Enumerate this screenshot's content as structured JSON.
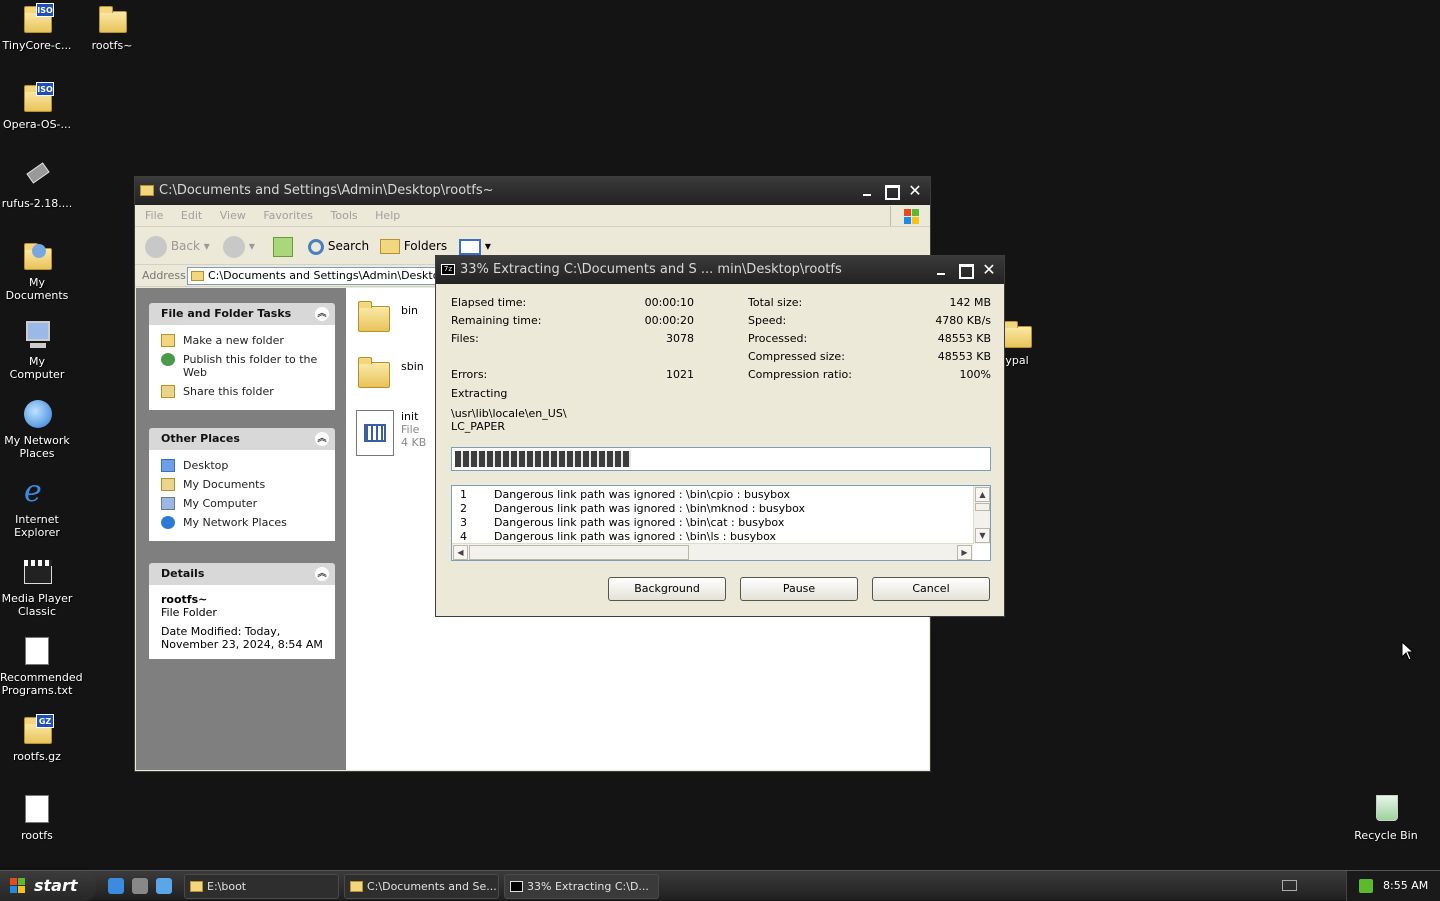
{
  "desktop": {
    "icons": [
      {
        "label": "TinyCore-c...",
        "icon": "iso-file-icon"
      },
      {
        "label": "rootfs~",
        "icon": "folder-icon"
      },
      {
        "label": "Opera-OS-...",
        "icon": "iso-file-icon"
      },
      {
        "label": "rufus-2.18....",
        "icon": "usb-drive-icon"
      },
      {
        "label": "My Documents",
        "icon": "my-documents-icon"
      },
      {
        "label": "My Computer",
        "icon": "my-computer-icon"
      },
      {
        "label": "My Network Places",
        "icon": "network-places-icon"
      },
      {
        "label": "Internet Explorer",
        "icon": "internet-explorer-icon"
      },
      {
        "label": "Media Player Classic",
        "icon": "media-player-icon"
      },
      {
        "label": "Recommended Programs.txt",
        "icon": "text-file-icon"
      },
      {
        "label": "rootfs.gz",
        "icon": "gz-archive-icon"
      },
      {
        "label": "rootfs",
        "icon": "file-icon"
      },
      {
        "label": "ypal",
        "icon": "folder-icon"
      },
      {
        "label": "Recycle Bin",
        "icon": "recycle-bin-icon"
      }
    ]
  },
  "explorer": {
    "title": "C:\\Documents and Settings\\Admin\\Desktop\\rootfs~",
    "menu": [
      "File",
      "Edit",
      "View",
      "Favorites",
      "Tools",
      "Help"
    ],
    "toolbar": {
      "back": "Back",
      "search": "Search",
      "folders": "Folders"
    },
    "address_label": "Address",
    "address_value": "C:\\Documents and Settings\\Admin\\Desktop\\rootfs~",
    "file_tasks": {
      "header": "File and Folder Tasks",
      "items": [
        "Make a new folder",
        "Publish this folder to the Web",
        "Share this folder"
      ]
    },
    "other_places": {
      "header": "Other Places",
      "items": [
        "Desktop",
        "My Documents",
        "My Computer",
        "My Network Places"
      ]
    },
    "details": {
      "header": "Details",
      "name": "rootfs~",
      "type": "File Folder",
      "modified": "Date Modified: Today, November 23, 2024, 8:54 AM"
    },
    "files": [
      {
        "name": "bin",
        "kind": "folder"
      },
      {
        "name": "sbin",
        "kind": "folder"
      },
      {
        "name": "init",
        "type": "File",
        "size": "4 KB",
        "kind": "file"
      }
    ]
  },
  "zip": {
    "title": "33% Extracting C:\\Documents and S ... min\\Desktop\\rootfs",
    "progress_fraction": 0.33,
    "left_stats": [
      {
        "label": "Elapsed time:",
        "value": "00:00:10"
      },
      {
        "label": "Remaining time:",
        "value": "00:00:20"
      },
      {
        "label": "Files:",
        "value": "3078"
      },
      {
        "label": "Errors:",
        "value": "1021"
      }
    ],
    "right_stats": [
      {
        "label": "Total size:",
        "value": "142 MB"
      },
      {
        "label": "Speed:",
        "value": "4780 KB/s"
      },
      {
        "label": "Processed:",
        "value": "48553 KB"
      },
      {
        "label": "Compressed size:",
        "value": "48553 KB"
      },
      {
        "label": "Compression ratio:",
        "value": "100%"
      }
    ],
    "status": "Extracting",
    "current_path": "\\usr\\lib\\locale\\en_US\\",
    "current_file": "LC_PAPER",
    "log": [
      {
        "n": "1",
        "text": "Dangerous link path was ignored : \\bin\\cpio : busybox"
      },
      {
        "n": "2",
        "text": "Dangerous link path was ignored : \\bin\\mknod : busybox"
      },
      {
        "n": "3",
        "text": "Dangerous link path was ignored : \\bin\\cat : busybox"
      },
      {
        "n": "4",
        "text": "Dangerous link path was ignored : \\bin\\ls : busybox"
      }
    ],
    "buttons": {
      "background": "Background",
      "pause": "Pause",
      "cancel": "Cancel"
    }
  },
  "taskbar": {
    "start": "start",
    "tasks": [
      "E:\\boot",
      "C:\\Documents and Se...",
      "33% Extracting C:\\D..."
    ],
    "clock": "8:55 AM"
  }
}
